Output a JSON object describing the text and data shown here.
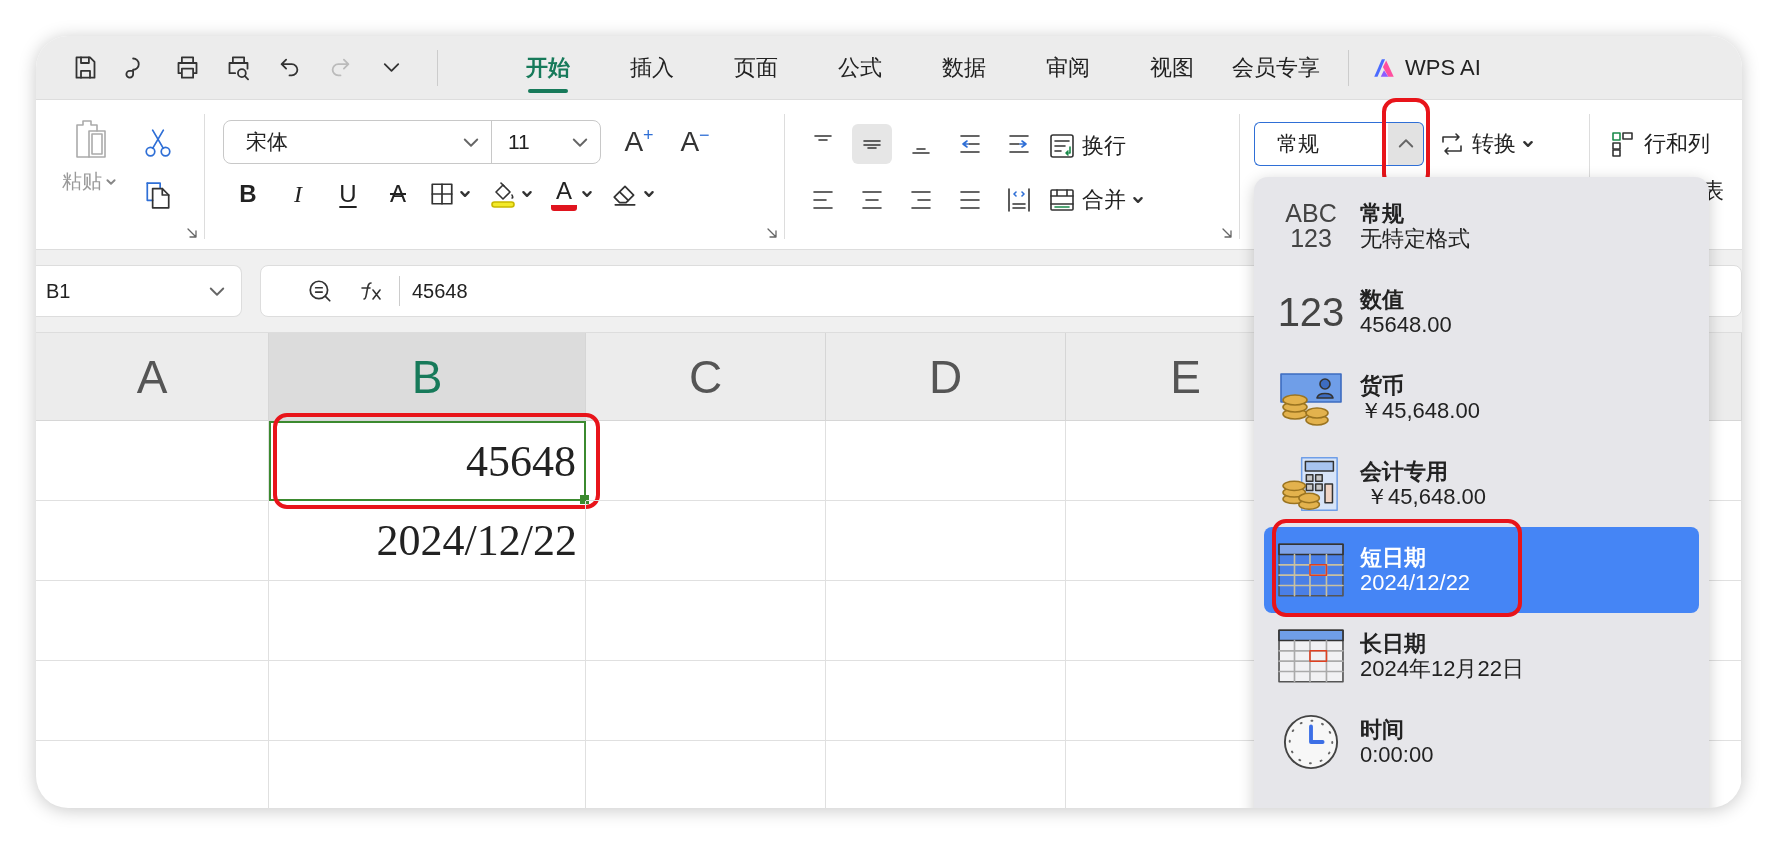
{
  "quick_access": [
    {
      "kind": "save",
      "disabled": false
    },
    {
      "kind": "format-painter",
      "disabled": false
    },
    {
      "kind": "print",
      "disabled": false
    },
    {
      "kind": "print-preview",
      "disabled": false
    },
    {
      "kind": "undo",
      "disabled": false
    },
    {
      "kind": "redo",
      "disabled": true
    },
    {
      "kind": "customize",
      "disabled": false
    }
  ],
  "tabs": [
    {
      "label": "开始",
      "selected": true
    },
    {
      "label": "插入",
      "selected": false
    },
    {
      "label": "页面",
      "selected": false
    },
    {
      "label": "公式",
      "selected": false
    },
    {
      "label": "数据",
      "selected": false
    },
    {
      "label": "审阅",
      "selected": false
    },
    {
      "label": "视图",
      "selected": false
    },
    {
      "label": "会员专享",
      "selected": false
    }
  ],
  "ai_button": {
    "label": "WPS AI"
  },
  "clipboard": {
    "paste_label": "粘贴",
    "paste_disabled": true
  },
  "font": {
    "name": "宋体",
    "size": "11"
  },
  "size_buttons": [
    {
      "glyph": "A",
      "sign": "+"
    },
    {
      "glyph": "A",
      "sign": "−"
    }
  ],
  "font_buttons": [
    {
      "kind": "bold",
      "glyph": "B"
    },
    {
      "kind": "italic",
      "glyph": "I"
    },
    {
      "kind": "underline",
      "glyph": "U"
    },
    {
      "kind": "strikethrough",
      "glyph": "A"
    },
    {
      "kind": "borders"
    },
    {
      "kind": "fill-color"
    },
    {
      "kind": "font-color",
      "glyph": "A"
    },
    {
      "kind": "clear"
    }
  ],
  "align_buttons": [
    {
      "kind": "top",
      "selected": false
    },
    {
      "kind": "middle",
      "selected": true
    },
    {
      "kind": "bottom",
      "selected": false
    },
    {
      "kind": "outdent",
      "selected": false
    },
    {
      "kind": "indent",
      "selected": false
    },
    {
      "kind": "left",
      "selected": false
    },
    {
      "kind": "center",
      "selected": false
    },
    {
      "kind": "right",
      "selected": false
    },
    {
      "kind": "justify",
      "selected": false
    },
    {
      "kind": "distributed",
      "selected": false
    }
  ],
  "wrap_label": "换行",
  "merge_label": "合并",
  "number_format": {
    "value": "常规",
    "expanded": true,
    "highlighted": true
  },
  "convert_label": "转换",
  "rows_cols_label": "行和列",
  "table_label": "表",
  "formula_bar": {
    "cell_ref": "B1",
    "formula": "45648"
  },
  "columns": [
    {
      "label": "A",
      "selected": false
    },
    {
      "label": "B",
      "selected": true
    },
    {
      "label": "C",
      "selected": false
    },
    {
      "label": "D",
      "selected": false
    },
    {
      "label": "E",
      "selected": false
    }
  ],
  "rows": [
    {
      "cells": [
        null,
        {
          "value": "45648",
          "selected": true,
          "highlighted": true
        },
        null,
        null,
        null
      ]
    },
    {
      "cells": [
        null,
        {
          "value": "2024/12/22",
          "selected": false,
          "highlighted": false
        },
        null,
        null,
        null
      ]
    },
    {
      "cells": [
        null,
        null,
        null,
        null,
        null
      ]
    },
    {
      "cells": [
        null,
        null,
        null,
        null,
        null
      ]
    },
    {
      "cells": [
        null,
        null,
        null,
        null,
        null
      ]
    }
  ],
  "format_menu": [
    {
      "kind": "general",
      "icon_text": [
        "ABC",
        "123"
      ],
      "title": "常规",
      "example": "无特定格式",
      "selected": false,
      "highlighted": false
    },
    {
      "kind": "number",
      "icon_text": [
        "123"
      ],
      "title": "数值",
      "example": "45648.00",
      "selected": false,
      "highlighted": false
    },
    {
      "kind": "currency",
      "title": "货币",
      "example": "￥45,648.00",
      "selected": false,
      "highlighted": false
    },
    {
      "kind": "accounting",
      "title": "会计专用",
      "example": " ￥45,648.00",
      "selected": false,
      "highlighted": false
    },
    {
      "kind": "short-date",
      "title": "短日期",
      "example": "2024/12/22",
      "selected": true,
      "highlighted": true
    },
    {
      "kind": "long-date",
      "title": "长日期",
      "example": "2024年12月22日",
      "selected": false,
      "highlighted": false
    },
    {
      "kind": "time",
      "title": "时间",
      "example": "0:00:00",
      "selected": false,
      "highlighted": false
    }
  ]
}
